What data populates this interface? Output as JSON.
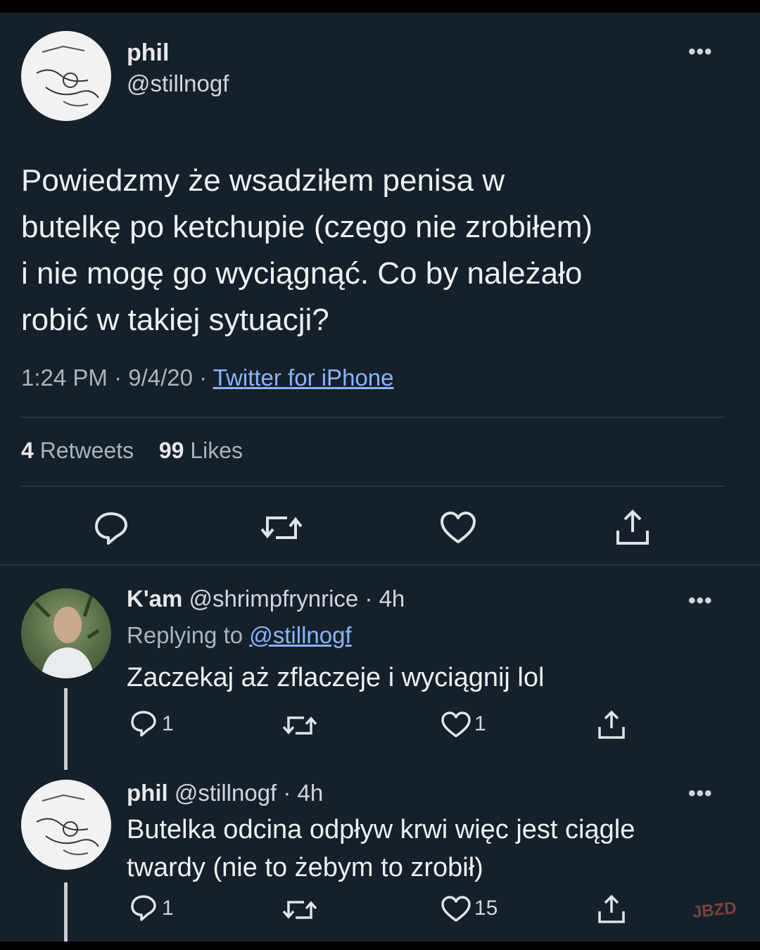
{
  "main_tweet": {
    "display_name": "phil",
    "handle": "@stillnogf",
    "text_lines": [
      "Powiedzmy że wsadziłem penisa w",
      "butelkę po ketchupie (czego nie zrobiłem)",
      "i nie mogę go wyciągnąć. Co by należało",
      "robić w takiej sytuacji?"
    ],
    "meta": {
      "time": "1:24 PM · 9/4/20 · ",
      "source": "Twitter for iPhone"
    },
    "stats": {
      "retweets_count": "4",
      "retweets_label": "Retweets",
      "likes_count": "99",
      "likes_label": "Likes"
    },
    "more": "•••"
  },
  "replies": [
    {
      "display_name": "K'am",
      "handle_time": "@shrimpfrynrice · 4h",
      "replying_label": "Replying to ",
      "replying_to": "@stillnogf",
      "text_lines": [
        "Zaczekaj aż zflaczeje i wyciągnij lol"
      ],
      "reply_count": "1",
      "like_count": "1",
      "more": "•••"
    },
    {
      "display_name": "phil",
      "handle_time": "@stillnogf · 4h",
      "text_lines": [
        "Butelka odcina odpływ krwi więc jest ciągle",
        "twardy (nie to żebym to zrobił)"
      ],
      "reply_count": "1",
      "like_count": "15",
      "more": "•••"
    }
  ],
  "watermark": "JBZD",
  "icons": [
    "reply-icon",
    "retweet-icon",
    "like-icon",
    "share-icon"
  ],
  "colors": {
    "background": "#15202b",
    "link": "#8ab4f8",
    "muted": "#8b98a5"
  }
}
